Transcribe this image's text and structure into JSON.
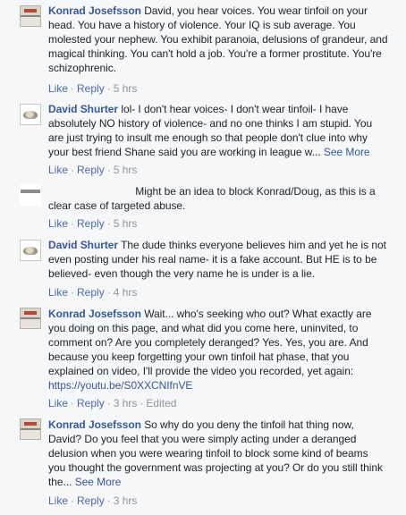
{
  "comments": [
    {
      "author": "Konrad Josefsson",
      "text": "David, you hear voices. You wear tinfoil on your head. You have a history of violence. Your IQ is sub average. You molested your nephew. You exhibit paranoia, delusions of grandeur, and magical thinking. You can't hold a job. You're a former prostitute. You're schizophrenic.",
      "like": "Like",
      "reply": "Reply",
      "time": "5 hrs"
    },
    {
      "author": "David Shurter",
      "text": "lol- I don't hear voices- I don't wear tinfoil- I have absolutely NO history of violence- and no one thinks I am stupid. You are just trying to insult me enough so that people don't clue into why your best friend Shane said you are working in league w...",
      "see_more": "See More",
      "like": "Like",
      "reply": "Reply",
      "time": "5 hrs"
    },
    {
      "author": "",
      "text": "Might be an idea to block Konrad/Doug, as this is a clear case of targeted abuse.",
      "like": "Like",
      "reply": "Reply",
      "time": "5 hrs"
    },
    {
      "author": "David Shurter",
      "text": "The dude thinks everyone believes him and yet he is not even posting under his real name- it is a fake account. But HE is to be believed- even though the very name he is under is a lie.",
      "like": "Like",
      "reply": "Reply",
      "time": "4 hrs"
    },
    {
      "author": "Konrad Josefsson",
      "text": "Wait... who's seeking who out? What exactly are you doing on this page, and what did you come here, uninvited, to comment on? Are you completely deranged? Yes. Yes, you are. And because you keep forgetting your own tinfoil hat phase, that you explained on video, I'll provide the video you recorded, yet again:",
      "link": "https://youtu.be/S0XXCNIfnVE",
      "like": "Like",
      "reply": "Reply",
      "time": "3 hrs",
      "edited": "Edited"
    },
    {
      "author": "Konrad Josefsson",
      "text": "So why do you deny the tinfoil hat thing now, David? Do you feel that you were simply acting under a deranged delusion when you were wearing tinfoil to block some kind of beams you thought the government was projecting at you? Or do you still think the...",
      "see_more": "See More",
      "like": "Like",
      "reply": "Reply",
      "time": "3 hrs"
    }
  ]
}
